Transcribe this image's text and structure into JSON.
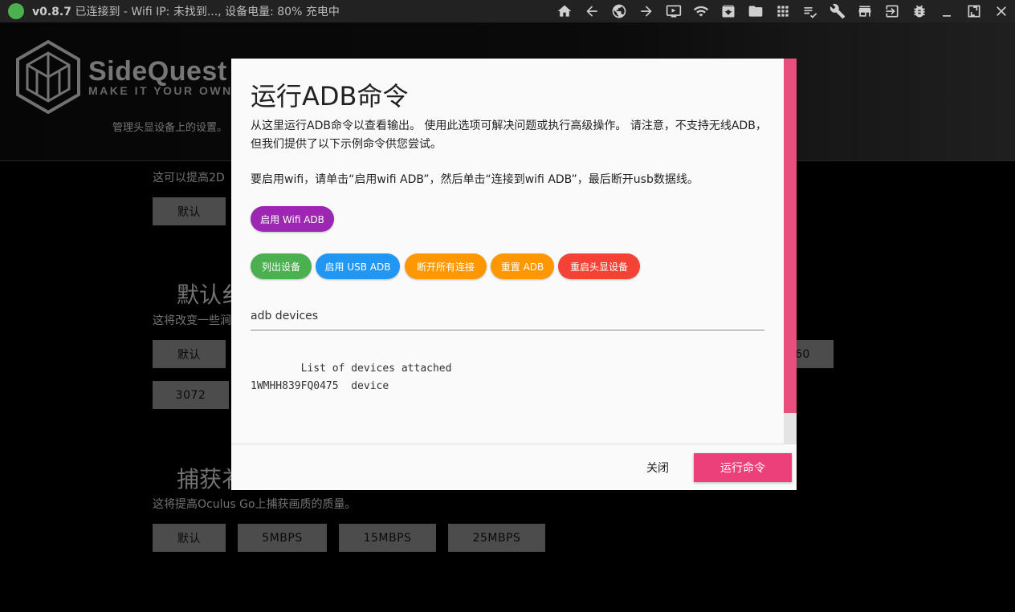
{
  "topbar": {
    "version": "v0.8.7",
    "status": "已连接到 - Wifi IP: 未找到..., 设备电量: 80% 充电中",
    "icons": [
      "home-icon",
      "back-icon",
      "globe-icon",
      "forward-icon",
      "tv-icon",
      "wifi-icon",
      "download-box-icon",
      "folder-icon",
      "apps-grid-icon",
      "checklist-icon",
      "wrench-icon",
      "store-icon",
      "exit-to-app-icon",
      "bug-icon",
      "minimize-icon",
      "maximize-icon",
      "close-icon"
    ]
  },
  "app": {
    "logo_title": "SideQuest",
    "logo_tagline": "MAKE IT YOUR OWN",
    "header_desc": "管理头显设备上的设置。",
    "section1_desc": "这可以提高2D",
    "section1_btn": "默认",
    "section2_heading": "默认纟",
    "section2_desc": "这将改变一些涧",
    "section2_btn_default": "默认",
    "section2_btn_3072": "3072",
    "section2_btn_right": "60",
    "section3_heading": "捕获衤",
    "section3_desc": "这将提高Oculus Go上捕获画质的质量。",
    "section3_buttons": [
      "默认",
      "5MBPS",
      "15MBPS",
      "25MBPS"
    ]
  },
  "modal": {
    "title": "运行ADB命令",
    "description": "从这里运行ADB命令以查看输出。 使用此选项可解决问题或执行高级操作。 请注意，不支持无线ADB，但我们提供了以下示例命令供您尝试。",
    "wifi_instructions": "要启用wifi，请单击“启用wifi ADB”，然后单击“连接到wifi ADB”，最后断开usb数据线。",
    "buttons": {
      "enable_wifi_adb": "启用 Wifi ADB",
      "list_devices": "列出设备",
      "enable_usb_adb": "启用 USB ADB",
      "disconnect_all": "断开所有连接",
      "reset_adb": "重置 ADB",
      "reboot_headset": "重启头显设备"
    },
    "command_value": "adb devices",
    "output": "        List of devices attached\n1WMHH839FQ0475  device",
    "close_label": "关闭",
    "run_label": "运行命令"
  },
  "colors": {
    "accent": "#ec407a",
    "purple": "#9c27b0",
    "green": "#4caf50",
    "blue": "#2196f3",
    "orange": "#ff9800",
    "red": "#f44336"
  }
}
